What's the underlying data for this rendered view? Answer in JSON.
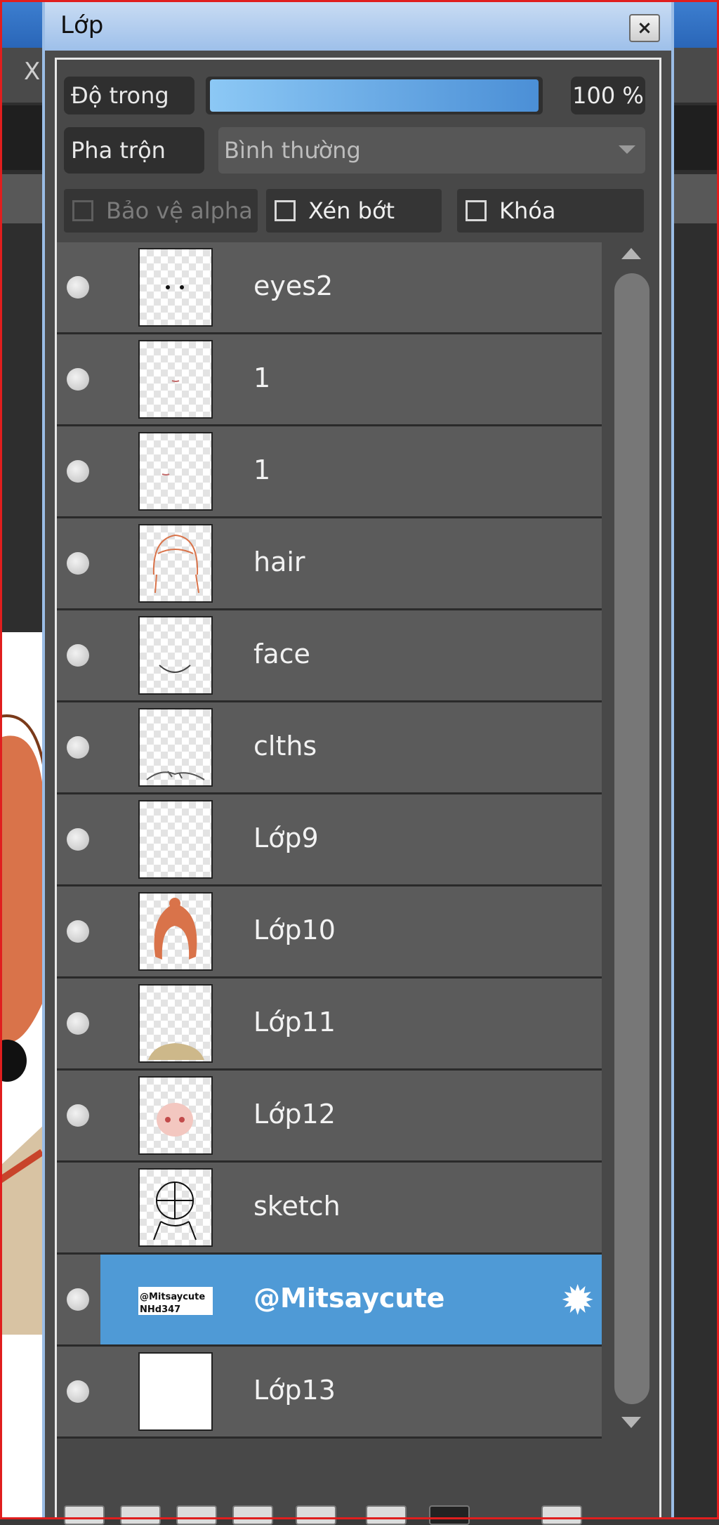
{
  "background": {
    "close_glyph": "X"
  },
  "panel": {
    "title": "Lớp",
    "close_icon": "×"
  },
  "opacity": {
    "label": "Độ trong",
    "value": "100 %",
    "level_fraction": 1.0
  },
  "blend": {
    "label": "Pha trộn",
    "selected": "Bình thường"
  },
  "checkboxes": {
    "protect_alpha": "Bảo vệ alpha",
    "clip": "Xén bớt",
    "lock": "Khóa"
  },
  "layers": [
    {
      "name": "eyes2"
    },
    {
      "name": "1"
    },
    {
      "name": "1"
    },
    {
      "name": "hair"
    },
    {
      "name": "face"
    },
    {
      "name": "clths"
    },
    {
      "name": "Lớp9"
    },
    {
      "name": "Lớp10"
    },
    {
      "name": "Lớp11"
    },
    {
      "name": "Lớp12"
    },
    {
      "name": "sketch"
    },
    {
      "name": "@Mitsaycute",
      "thumb_text_1": "@Mitsaycute",
      "thumb_text_2": "NHd347"
    },
    {
      "name": "Lớp13"
    }
  ],
  "colors": {
    "accent": "#4f9ad6",
    "hair": "#d9734a"
  }
}
